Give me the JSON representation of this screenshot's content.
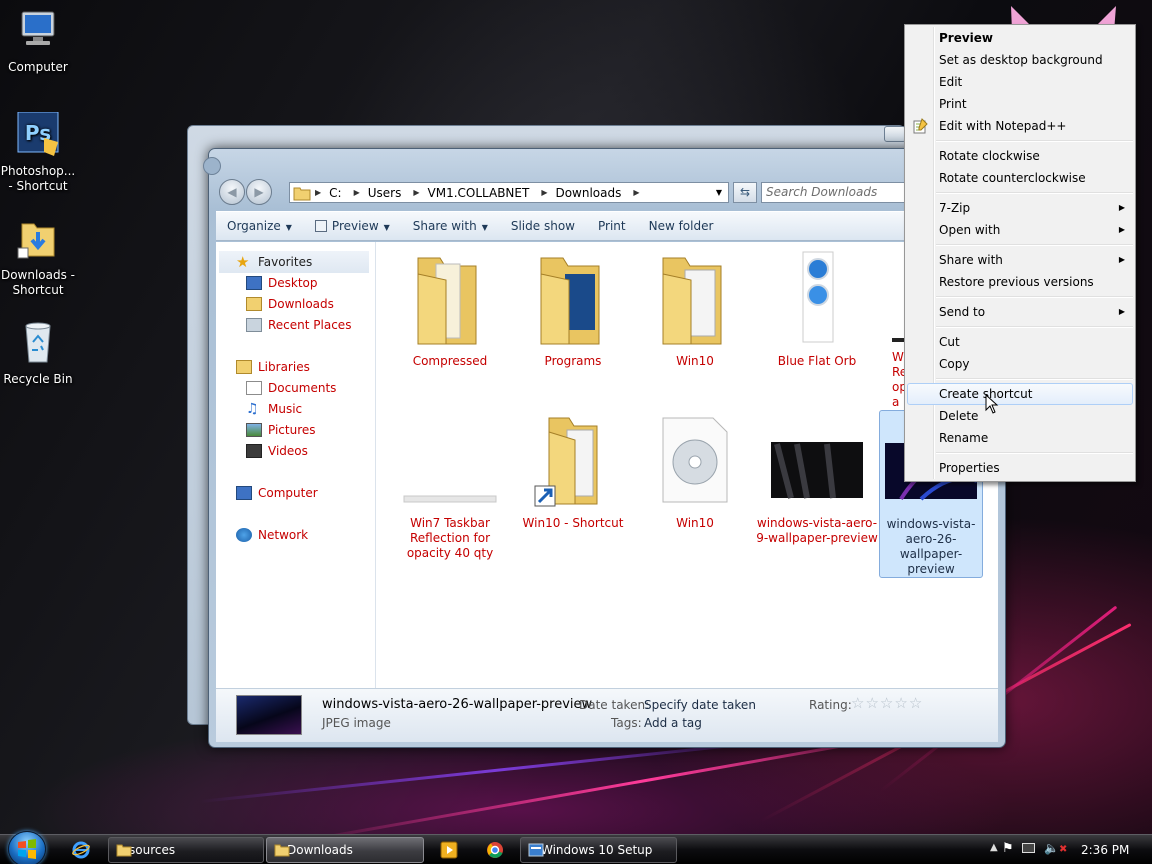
{
  "desktop": {
    "icons": [
      {
        "label": "Computer"
      },
      {
        "label": "Photoshop... - Shortcut"
      },
      {
        "label": "Downloads - Shortcut"
      },
      {
        "label": "Recycle Bin"
      }
    ]
  },
  "explorer": {
    "address": {
      "segments": [
        "C:",
        "Users",
        "VM1.COLLABNET",
        "Downloads"
      ]
    },
    "search_placeholder": "Search Downloads",
    "toolbar": {
      "organize": "Organize",
      "preview": "Preview",
      "share_with": "Share with",
      "slide_show": "Slide show",
      "print": "Print",
      "new_folder": "New folder"
    },
    "nav": {
      "favorites": "Favorites",
      "desktop": "Desktop",
      "downloads": "Downloads",
      "recent_places": "Recent Places",
      "libraries": "Libraries",
      "documents": "Documents",
      "music": "Music",
      "pictures": "Pictures",
      "videos": "Videos",
      "computer": "Computer",
      "network": "Network"
    },
    "files": [
      {
        "name": "Compressed"
      },
      {
        "name": "Programs"
      },
      {
        "name": "Win10"
      },
      {
        "name": "Blue Flat Orb"
      },
      {
        "name": "W Re opa"
      },
      {
        "name": "Win7 Taskbar Reflection for opacity 40 qty"
      },
      {
        "name": "Win10 - Shortcut"
      },
      {
        "name": "Win10"
      },
      {
        "name": "windows-vista-aero-9-wallpaper-preview"
      },
      {
        "name": "windows-vista-aero-26-wallpaper-preview"
      }
    ],
    "details": {
      "file_name": "windows-vista-aero-26-wallpaper-preview",
      "file_type": "JPEG image",
      "date_taken_label": "Date taken:",
      "date_taken_value": "Specify date taken",
      "tags_label": "Tags:",
      "tags_value": "Add a tag",
      "rating_label": "Rating:",
      "rating_stars": 0
    }
  },
  "context_menu": {
    "items": [
      {
        "label": "Preview"
      },
      {
        "label": "Set as desktop background"
      },
      {
        "label": "Edit"
      },
      {
        "label": "Print"
      },
      {
        "label": "Edit with Notepad++"
      },
      {
        "label": "Rotate clockwise"
      },
      {
        "label": "Rotate counterclockwise"
      },
      {
        "label": "7-Zip"
      },
      {
        "label": "Open with"
      },
      {
        "label": "Share with"
      },
      {
        "label": "Restore previous versions"
      },
      {
        "label": "Send to"
      },
      {
        "label": "Cut"
      },
      {
        "label": "Copy"
      },
      {
        "label": "Create shortcut"
      },
      {
        "label": "Delete"
      },
      {
        "label": "Rename"
      },
      {
        "label": "Properties"
      }
    ],
    "highlighted": "Create shortcut"
  },
  "taskbar": {
    "buttons": [
      {
        "label": "sources"
      },
      {
        "label": "Downloads"
      },
      {
        "label": "Windows 10 Setup"
      }
    ],
    "clock": "2:36 PM"
  },
  "colors": {
    "file_label": "#c50000",
    "selection": "#cfe6fc",
    "menu_highlight": "#e4eefb"
  }
}
